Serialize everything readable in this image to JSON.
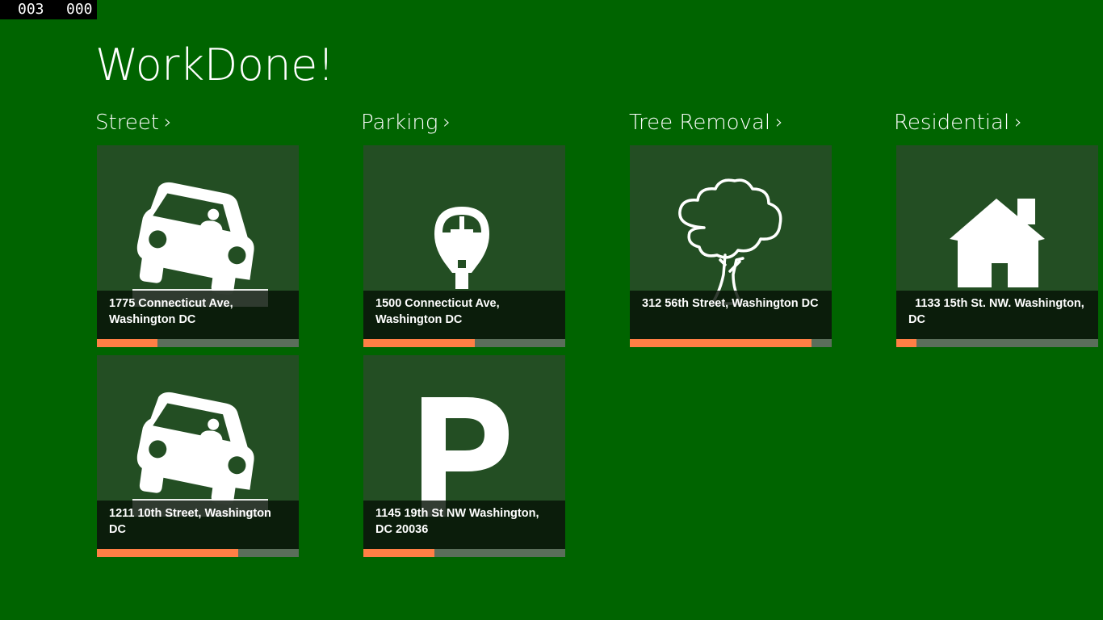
{
  "debug_counter": {
    "left": "003",
    "right": "000"
  },
  "app": {
    "title": "WorkDone!"
  },
  "groups": [
    {
      "header": "Street",
      "tiles": [
        {
          "icon": "car-icon",
          "address": "1775 Connecticut Ave, Washington DC",
          "progress": 0.3
        },
        {
          "icon": "car-icon",
          "address": "1211 10th Street, Washington DC",
          "progress": 0.7
        }
      ]
    },
    {
      "header": "Parking",
      "tiles": [
        {
          "icon": "parking-meter-icon",
          "address": "1500 Connecticut Ave, Washington DC",
          "progress": 0.55
        },
        {
          "icon": "parking-p-icon",
          "address": "1145 19th St NW Washington, DC 20036",
          "progress": 0.35
        }
      ]
    },
    {
      "header": "Tree Removal",
      "tiles": [
        {
          "icon": "tree-icon",
          "address": "312 56th Street, Washington DC",
          "progress": 0.9
        }
      ]
    },
    {
      "header": "Residential",
      "tiles": [
        {
          "icon": "house-icon",
          "address": "  1133 15th St. NW. Washington, DC",
          "progress": 0.1
        }
      ]
    }
  ],
  "colors": {
    "background": "#006400",
    "tile": "#234e23",
    "progress_fill": "#ff7f45",
    "progress_track": "#5a6e5a"
  }
}
